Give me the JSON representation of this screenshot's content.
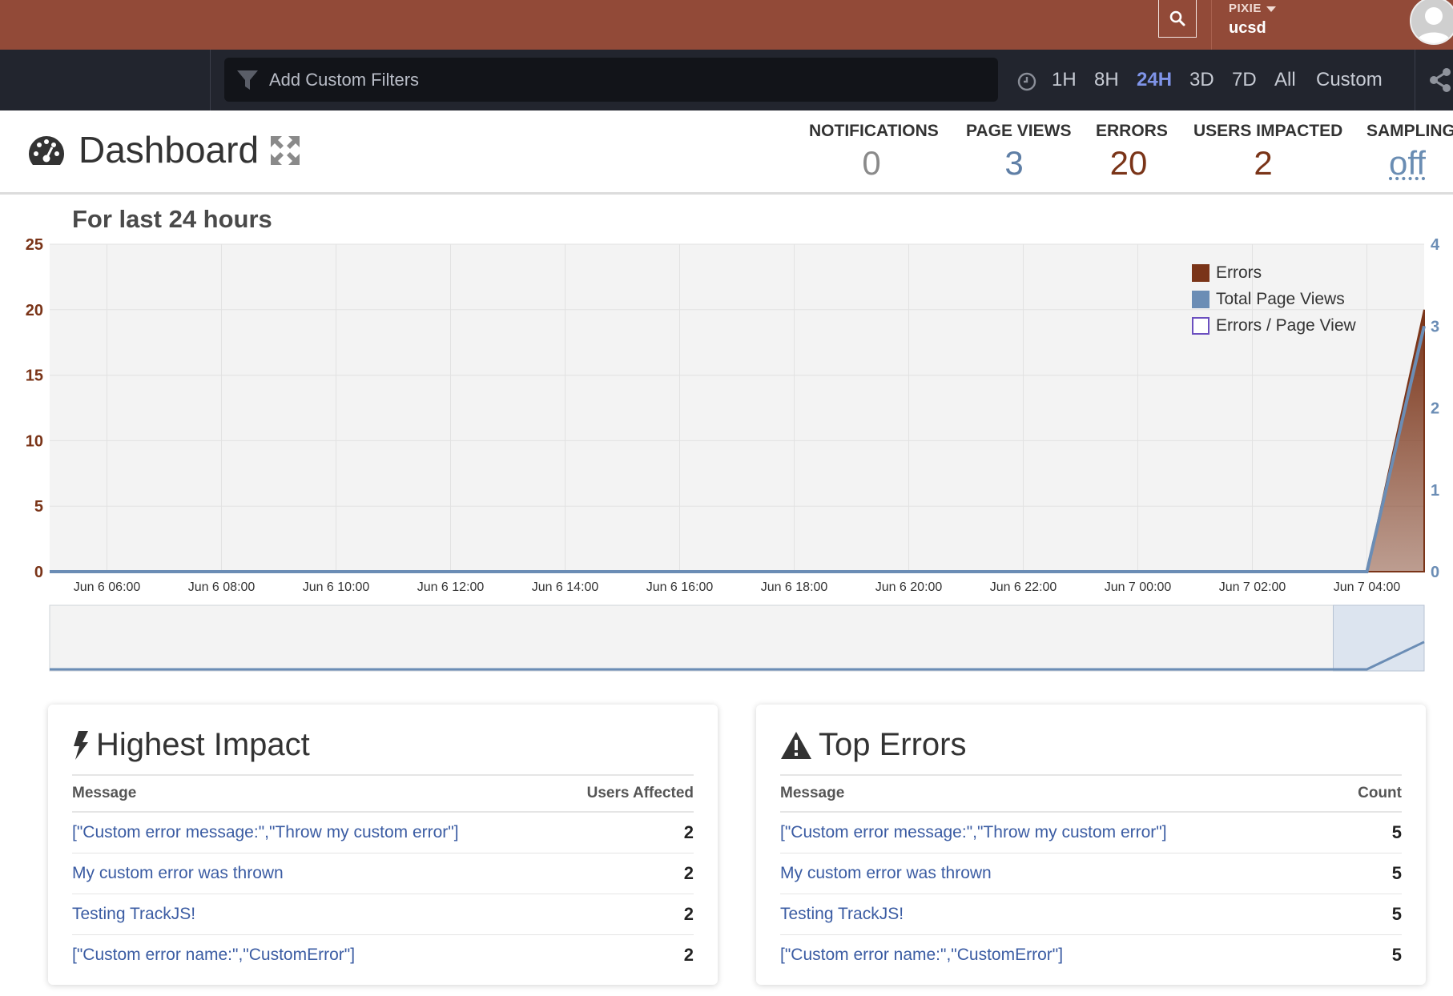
{
  "topbar": {
    "org_label": "PIXIE",
    "org_name": "ucsd",
    "search_icon": "search-icon",
    "avatar_icon": "user-avatar"
  },
  "filterbar": {
    "placeholder": "Add Custom Filters",
    "filter_icon": "funnel-icon",
    "time_icon": "clock-icon",
    "ranges": [
      "1H",
      "8H",
      "24H",
      "3D",
      "7D",
      "All",
      "Custom"
    ],
    "active_range": "24H",
    "share_icon": "share-icon"
  },
  "header": {
    "title": "Dashboard",
    "title_icon": "dashboard-gauge-icon",
    "expand_icon": "expand-arrows-icon",
    "stats": [
      {
        "label": "NOTIFICATIONS",
        "value": "0",
        "color": "#8a8a8a"
      },
      {
        "label": "PAGE VIEWS",
        "value": "3",
        "color": "#5f7fa6"
      },
      {
        "label": "ERRORS",
        "value": "20",
        "color": "#7a3418"
      },
      {
        "label": "USERS IMPACTED",
        "value": "2",
        "color": "#7a3418"
      },
      {
        "label": "SAMPLING",
        "value": "off",
        "color": "#6a8db3"
      }
    ]
  },
  "chart_data": {
    "type": "area",
    "title": "For last 24 hours",
    "x_ticks": [
      "Jun 6 06:00",
      "Jun 6 08:00",
      "Jun 6 10:00",
      "Jun 6 12:00",
      "Jun 6 14:00",
      "Jun 6 16:00",
      "Jun 6 18:00",
      "Jun 6 20:00",
      "Jun 6 22:00",
      "Jun 7 00:00",
      "Jun 7 02:00",
      "Jun 7 04:00"
    ],
    "x_range_hours": [
      "Jun 6 05:00",
      "Jun 7 05:00"
    ],
    "left_axis": {
      "ticks": [
        0,
        5,
        10,
        15,
        20,
        25
      ],
      "ylim": [
        0,
        25
      ],
      "color": "#7a3418"
    },
    "right_axis": {
      "ticks": [
        0,
        1,
        2,
        3,
        4
      ],
      "ylim": [
        0,
        4
      ],
      "color": "#6b8db5"
    },
    "series": [
      {
        "name": "Errors",
        "axis": "left",
        "color": "#7a3418",
        "style": "area",
        "points": [
          [
            "Jun 6 05:00",
            0
          ],
          [
            "Jun 7 04:00",
            0
          ],
          [
            "Jun 7 05:00",
            20
          ]
        ]
      },
      {
        "name": "Total Page Views",
        "axis": "right",
        "color": "#6b8db5",
        "style": "line",
        "points": [
          [
            "Jun 6 05:00",
            0
          ],
          [
            "Jun 7 04:00",
            0
          ],
          [
            "Jun 7 05:00",
            3
          ]
        ]
      },
      {
        "name": "Errors / Page View",
        "axis": "left",
        "color": "#6b4fbf",
        "style": "outline",
        "points": []
      }
    ],
    "legend_position": "top-right",
    "grid": true,
    "navigator_selection": [
      "Jun 7 04:00",
      "Jun 7 05:00"
    ]
  },
  "panels": {
    "highest_impact": {
      "title": "Highest Impact",
      "icon": "lightning-bolt-icon",
      "col_message": "Message",
      "col_value": "Users Affected",
      "rows": [
        {
          "message": "[\"Custom error message:\",\"Throw my custom error\"]",
          "value": "2"
        },
        {
          "message": "My custom error was thrown",
          "value": "2"
        },
        {
          "message": "Testing TrackJS!",
          "value": "2"
        },
        {
          "message": "[\"Custom error name:\",\"CustomError\"]",
          "value": "2"
        }
      ]
    },
    "top_errors": {
      "title": "Top Errors",
      "icon": "warning-triangle-icon",
      "col_message": "Message",
      "col_value": "Count",
      "rows": [
        {
          "message": "[\"Custom error message:\",\"Throw my custom error\"]",
          "value": "5"
        },
        {
          "message": "My custom error was thrown",
          "value": "5"
        },
        {
          "message": "Testing TrackJS!",
          "value": "5"
        },
        {
          "message": "[\"Custom error name:\",\"CustomError\"]",
          "value": "5"
        }
      ]
    }
  }
}
